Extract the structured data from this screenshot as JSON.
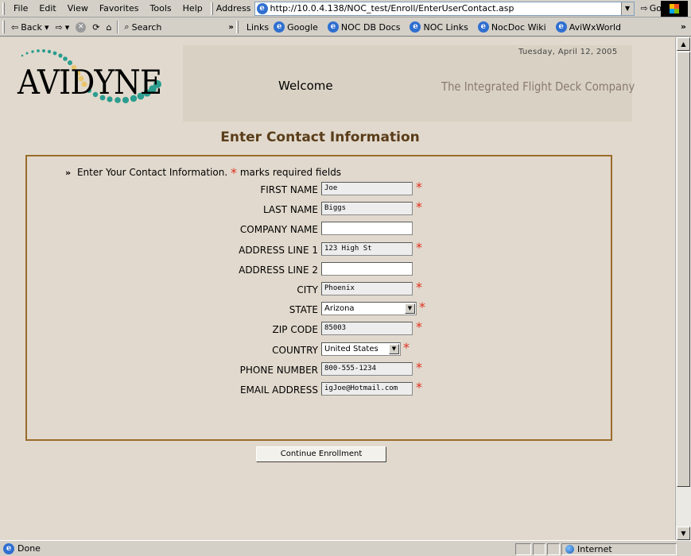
{
  "menubar": {
    "items": [
      "File",
      "Edit",
      "View",
      "Favorites",
      "Tools",
      "Help"
    ],
    "address_label": "Address",
    "url": "http://10.0.4.138/NOC_test/Enroll/EnterUserContact.asp",
    "go_label": "Go"
  },
  "toolbar": {
    "back_label": "Back",
    "search_label": "Search",
    "links_label": "Links",
    "links": [
      "Google",
      "NOC DB Docs",
      "NOC Links",
      "NocDoc Wiki",
      "AviWxWorld"
    ]
  },
  "header": {
    "logo_text": "AVIDYNE",
    "welcome": "Welcome",
    "tagline": "The Integrated Flight Deck Company",
    "date": "Tuesday, April 12, 2005"
  },
  "page": {
    "title": "Enter Contact Information",
    "instruction": "Enter Your Contact Information.",
    "instruction_suffix": "marks required fields",
    "bullets": "»",
    "required_mark": "*"
  },
  "form": {
    "fields": [
      {
        "label": "FIRST NAME",
        "value": "Joe",
        "required": true,
        "type": "text"
      },
      {
        "label": "LAST NAME",
        "value": "Biggs",
        "required": true,
        "type": "text"
      },
      {
        "label": "COMPANY NAME",
        "value": "",
        "required": false,
        "type": "text"
      },
      {
        "label": "ADDRESS LINE 1",
        "value": "123 High St",
        "required": true,
        "type": "text"
      },
      {
        "label": "ADDRESS LINE 2",
        "value": "",
        "required": false,
        "type": "text"
      },
      {
        "label": "CITY",
        "value": "Phoenix",
        "required": true,
        "type": "text"
      },
      {
        "label": "STATE",
        "value": "Arizona",
        "required": true,
        "type": "select"
      },
      {
        "label": "ZIP CODE",
        "value": "85003",
        "required": true,
        "type": "text"
      },
      {
        "label": "COUNTRY",
        "value": "United States",
        "required": true,
        "type": "select"
      },
      {
        "label": "PHONE NUMBER",
        "value": "800-555-1234",
        "required": true,
        "type": "text"
      },
      {
        "label": "EMAIL ADDRESS",
        "value": "igJoe@Hotmail.com",
        "required": true,
        "type": "text"
      }
    ],
    "continue_label": "Continue Enrollment"
  },
  "status": {
    "text": "Done",
    "zone": "Internet"
  },
  "colors": {
    "page_bg": "#e1d9cd",
    "title": "#5a3d1a",
    "border": "#9a6b2c",
    "required": "#e03020"
  }
}
